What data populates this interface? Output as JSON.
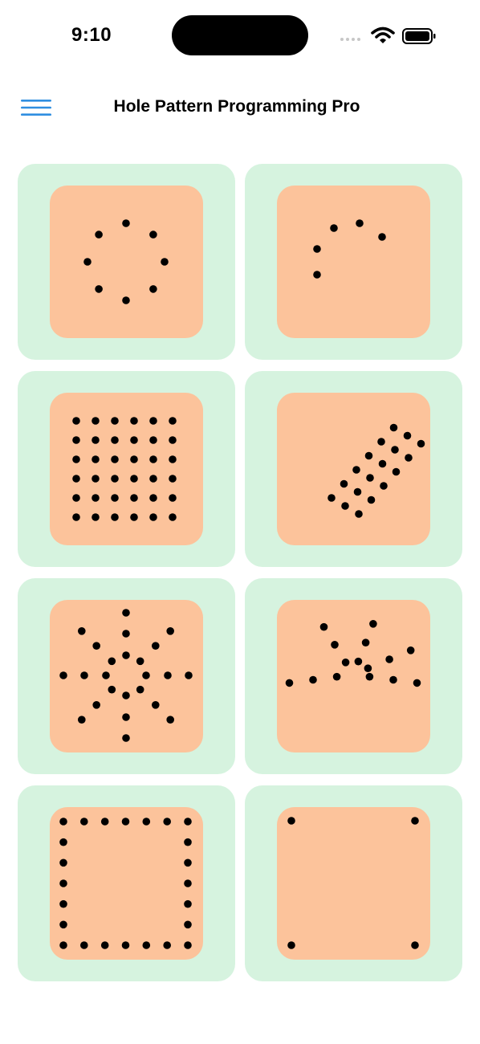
{
  "status_bar": {
    "time": "9:10"
  },
  "nav": {
    "title": "Hole Pattern Programming Pro",
    "menu_icon": "hamburger-menu-icon",
    "accent": "#2f8ee0"
  },
  "colors": {
    "tile_bg": "#d6f3df",
    "plate_bg": "#fcc39b",
    "hole": "#000000"
  },
  "patterns": [
    {
      "name": "bolt-circle"
    },
    {
      "name": "arc"
    },
    {
      "name": "grid"
    },
    {
      "name": "angled-grid"
    },
    {
      "name": "radial"
    },
    {
      "name": "fan"
    },
    {
      "name": "square-perimeter"
    },
    {
      "name": "corners"
    }
  ]
}
